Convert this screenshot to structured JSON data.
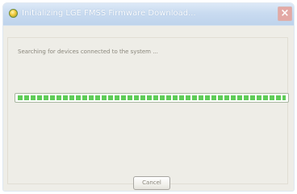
{
  "window": {
    "title": "Initializing LGE FMSS Firmware Download..."
  },
  "content": {
    "status_text": "Searching for devices connected to the system ..."
  },
  "progress": {
    "fraction": 1.0
  },
  "buttons": {
    "cancel_label": "Cancel"
  },
  "colors": {
    "progress_segment": "#5fcc58",
    "titlebar": "#c9dbf0",
    "close_button": "#e3a9a5"
  },
  "icons": {
    "app": "app-icon",
    "close": "close-icon"
  }
}
